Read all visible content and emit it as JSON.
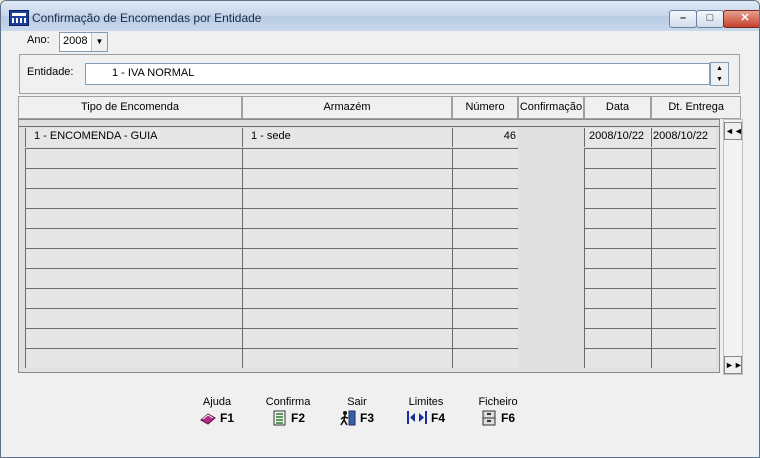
{
  "window": {
    "title": "Confirmação de Encomendas por Entidade"
  },
  "ano": {
    "label": "Ano:",
    "value": "2008"
  },
  "entidade": {
    "label": "Entidade:",
    "value": "1 - IVA NORMAL"
  },
  "columns": [
    "Tipo de Encomenda",
    "Armazém",
    "Número",
    "Confirmação",
    "Data",
    "Dt. Entrega"
  ],
  "rows": [
    {
      "tipo": "1 - ENCOMENDA - GUIA",
      "armazem": "1 - sede",
      "numero": "46",
      "confirmacao": "",
      "data": "2008/10/22",
      "entrega": "2008/10/22"
    }
  ],
  "functionKeys": [
    {
      "label": "Ajuda",
      "key": "F1",
      "icon": "help-book-icon"
    },
    {
      "label": "Confirma",
      "key": "F2",
      "icon": "checklist-icon"
    },
    {
      "label": "Sair",
      "key": "F3",
      "icon": "exit-icon"
    },
    {
      "label": "Limites",
      "key": "F4",
      "icon": "limits-icon"
    },
    {
      "label": "Ficheiro",
      "key": "F6",
      "icon": "file-cabinet-icon"
    }
  ]
}
